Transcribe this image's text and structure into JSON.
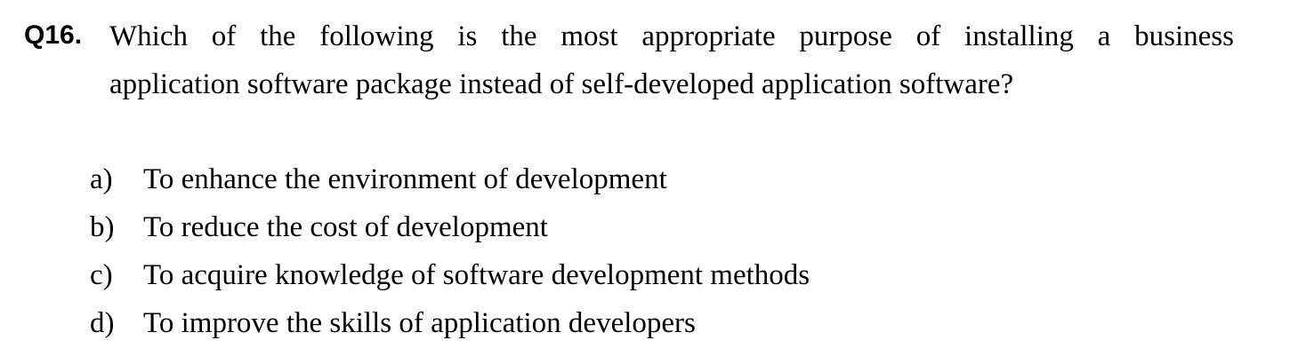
{
  "question": {
    "number": "Q16.",
    "text_line_1": "Which of the following is the most appropriate purpose of installing a business",
    "text_line_2": "application software package instead of self-developed application software?"
  },
  "options": [
    {
      "letter": "a)",
      "text": "To enhance the environment of development"
    },
    {
      "letter": "b)",
      "text": "To reduce the cost of development"
    },
    {
      "letter": "c)",
      "text": "To acquire knowledge of software development methods"
    },
    {
      "letter": "d)",
      "text": "To improve the skills of application developers"
    }
  ]
}
